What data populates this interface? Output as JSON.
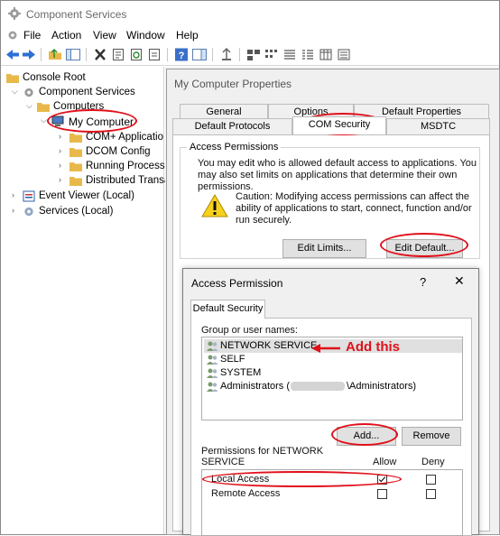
{
  "window": {
    "title": "Component Services"
  },
  "menu": [
    "File",
    "Action",
    "View",
    "Window",
    "Help"
  ],
  "tree": [
    {
      "label": "Console Root"
    },
    {
      "label": "Component Services"
    },
    {
      "label": "Computers"
    },
    {
      "label": "My Computer"
    },
    {
      "label": "COM+ Applicatio"
    },
    {
      "label": "DCOM Config"
    },
    {
      "label": "Running Processe"
    },
    {
      "label": "Distributed Transa"
    },
    {
      "label": "Event Viewer (Local)"
    },
    {
      "label": "Services (Local)"
    }
  ],
  "properties": {
    "title": "My Computer Properties",
    "tabs_row1": [
      "General",
      "Options",
      "Default Properties"
    ],
    "tabs_row2": [
      "Default Protocols",
      "COM Security",
      "MSDTC"
    ],
    "group_title": "Access Permissions",
    "desc": "You may edit who is allowed default access to applications. You may also set limits on applications that determine their own permissions.",
    "caution": "Caution: Modifying access permissions can affect the ability of applications to start, connect, function and/or run securely.",
    "edit_limits": "Edit Limits...",
    "edit_default": "Edit Default..."
  },
  "access_permission": {
    "title": "Access Permission",
    "help": "?",
    "close": "✕",
    "tab": "Default Security",
    "group_label": "Group or user names:",
    "users": [
      "NETWORK SERVICE",
      "SELF",
      "SYSTEM",
      "Administrators ("
    ],
    "admin_suffix": "\\Administrators)",
    "add_button": "Add...",
    "remove_button": "Remove",
    "perm_label_line1": "Permissions for NETWORK",
    "perm_label_line2": "SERVICE",
    "allow": "Allow",
    "deny": "Deny",
    "permissions": [
      {
        "name": "Local Access",
        "allow": true,
        "deny": false
      },
      {
        "name": "Remote Access",
        "allow": false,
        "deny": false
      }
    ]
  },
  "annotation": {
    "text": "Add this",
    "color": "#e0101a"
  }
}
